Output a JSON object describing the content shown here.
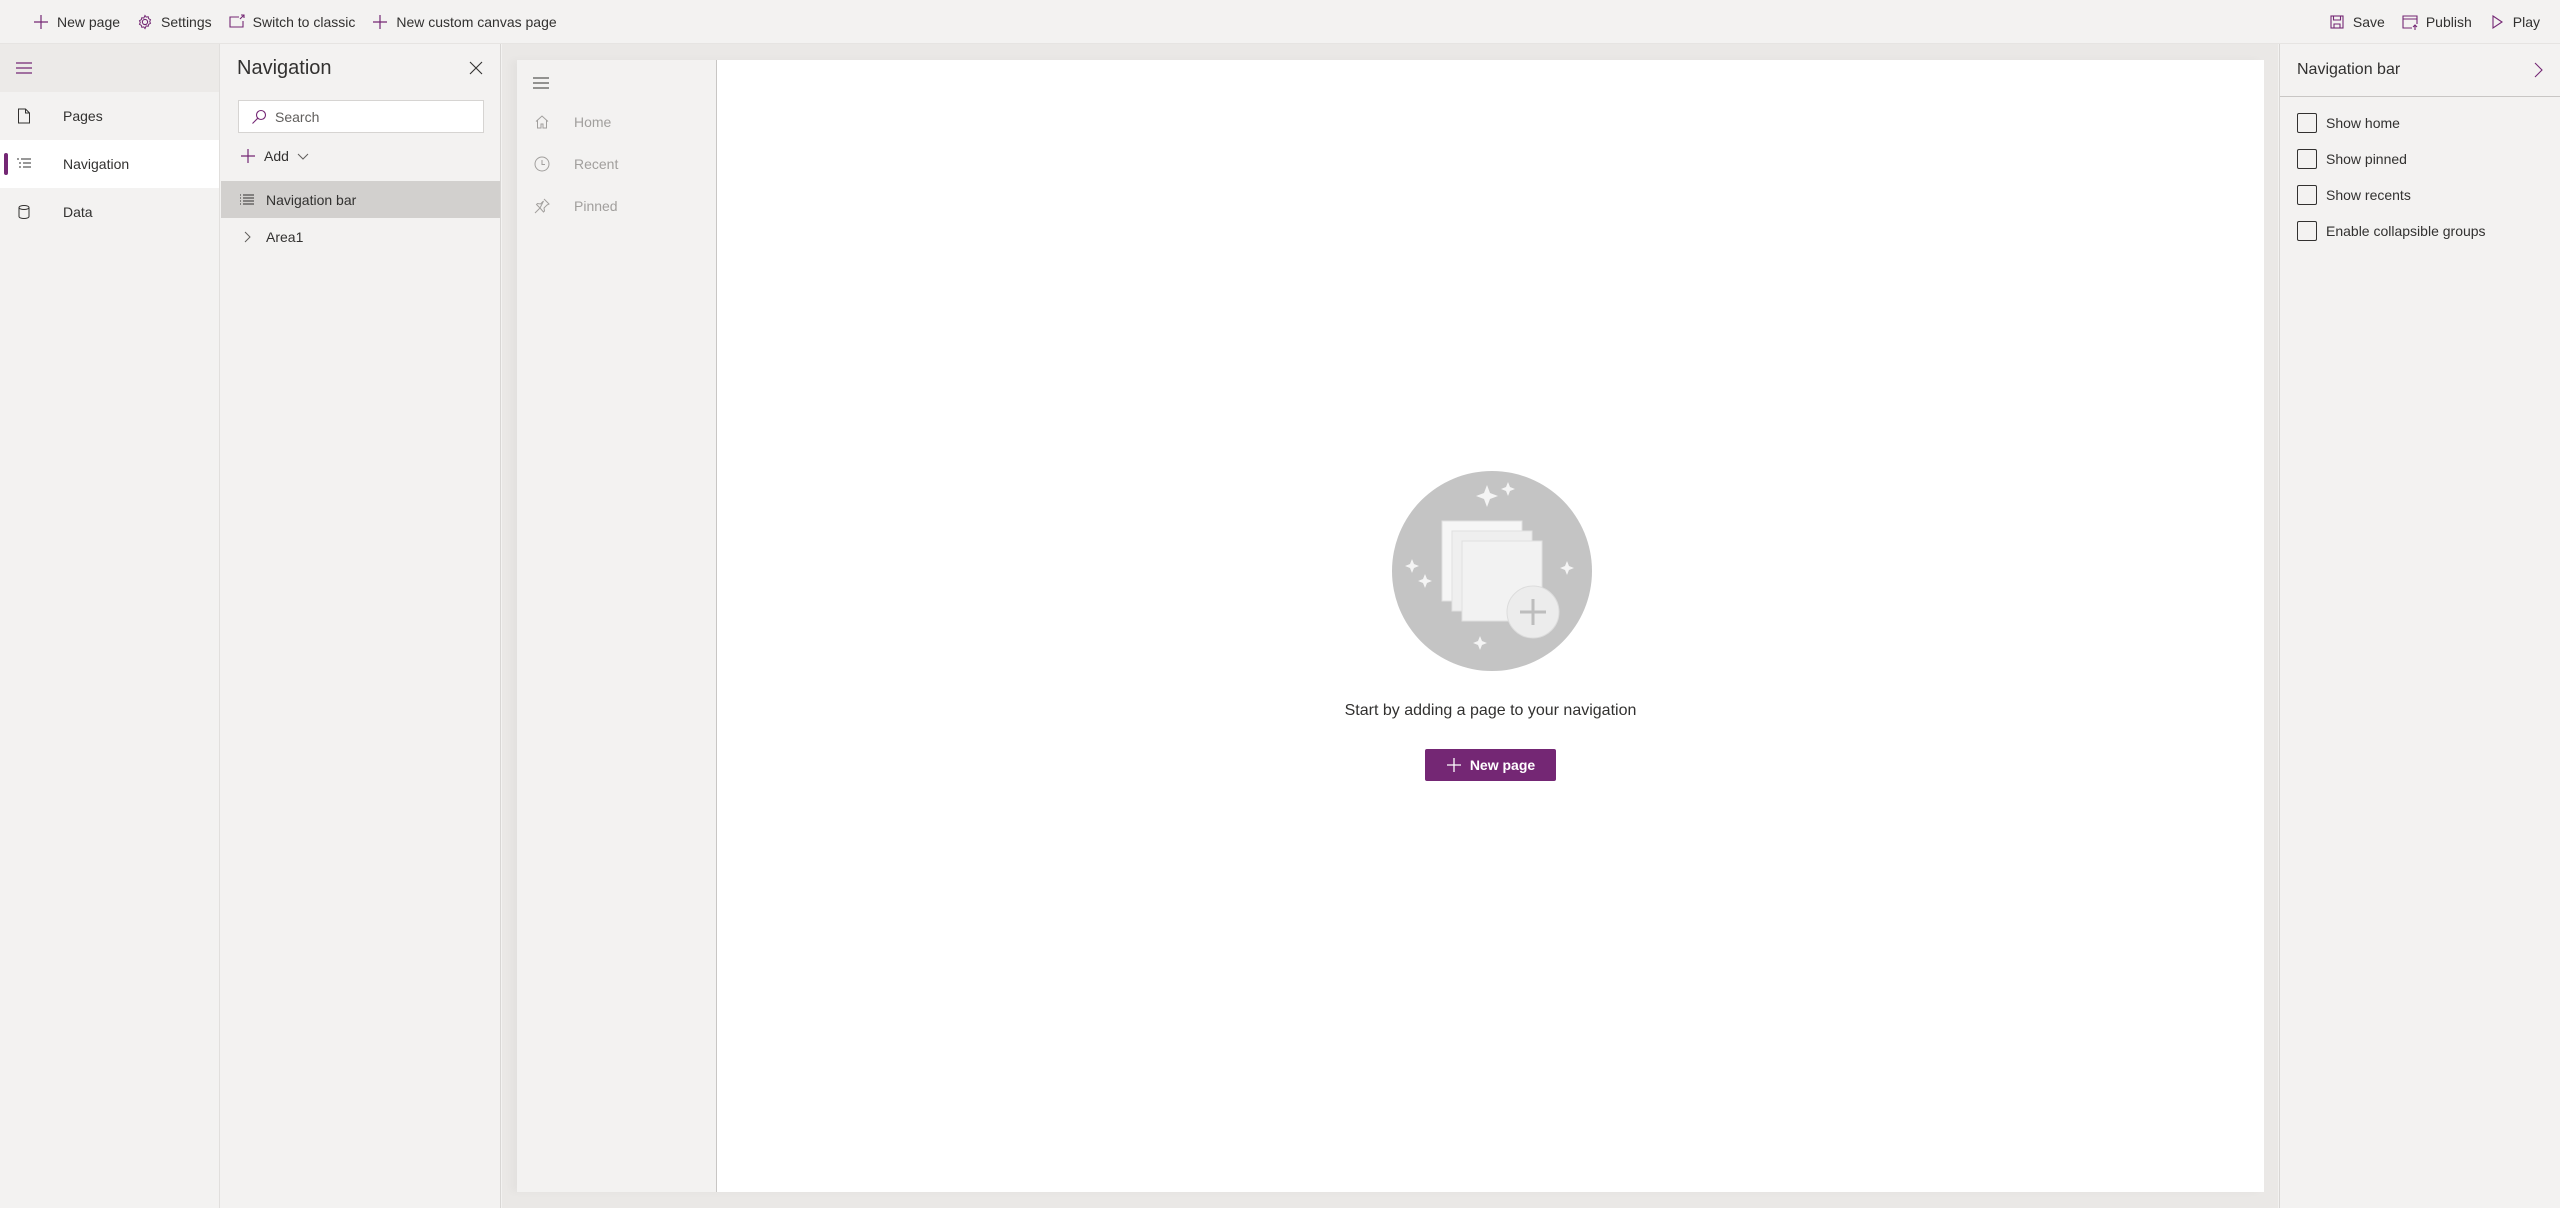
{
  "topbar": {
    "left": [
      {
        "label": "New page",
        "icon": "plus-icon"
      },
      {
        "label": "Settings",
        "icon": "gear-icon"
      },
      {
        "label": "Switch to classic",
        "icon": "switch-icon"
      },
      {
        "label": "New custom canvas page",
        "icon": "plus-icon"
      }
    ],
    "right": [
      {
        "label": "Save",
        "icon": "save-icon"
      },
      {
        "label": "Publish",
        "icon": "publish-icon"
      },
      {
        "label": "Play",
        "icon": "play-icon"
      }
    ]
  },
  "rail": {
    "items": [
      {
        "label": "Pages",
        "icon": "page-icon",
        "active": false
      },
      {
        "label": "Navigation",
        "icon": "navigation-list-icon",
        "active": true
      },
      {
        "label": "Data",
        "icon": "database-icon",
        "active": false
      }
    ]
  },
  "navpanel": {
    "title": "Navigation",
    "search_placeholder": "Search",
    "search_value": "",
    "add_label": "Add",
    "tree": [
      {
        "label": "Navigation bar",
        "icon": "list-icon",
        "selected": true
      },
      {
        "label": "Area1",
        "icon": "chevron-right-icon",
        "selected": false
      }
    ]
  },
  "preview": {
    "nav_items": [
      {
        "label": "Home",
        "icon": "home-icon"
      },
      {
        "label": "Recent",
        "icon": "clock-icon"
      },
      {
        "label": "Pinned",
        "icon": "pin-icon"
      }
    ],
    "empty_message": "Start by adding a page to your navigation",
    "new_page_label": "New page"
  },
  "props": {
    "title": "Navigation bar",
    "options": [
      {
        "label": "Show home",
        "checked": false
      },
      {
        "label": "Show pinned",
        "checked": false
      },
      {
        "label": "Show recents",
        "checked": false
      },
      {
        "label": "Enable collapsible groups",
        "checked": false
      }
    ]
  },
  "colors": {
    "accent": "#742774",
    "panel_bg": "#f3f2f1",
    "canvas_bg": "#eae8e6",
    "selected_row": "#d2d0ce",
    "muted_text": "#a19f9d"
  }
}
